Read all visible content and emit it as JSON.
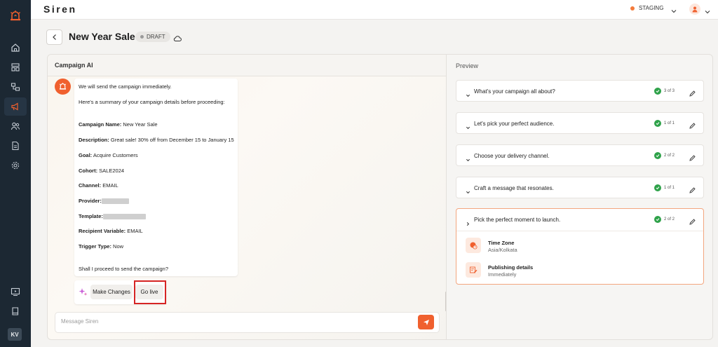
{
  "app": {
    "brand": "Siren",
    "environment": "STAGING",
    "user_initials": "KV"
  },
  "header": {
    "title": "New Year Sale",
    "status_badge": "DRAFT"
  },
  "campaign_ai": {
    "panel_title": "Campaign AI",
    "message": {
      "intro": "We will send the campaign immediately.",
      "summary_intro": "Here's a summary of your campaign details before proceeding:",
      "fields": [
        {
          "label": "Campaign Name:",
          "value": "New Year Sale"
        },
        {
          "label": "Description:",
          "value": "Great sale! 30% off from December 15 to January 15"
        },
        {
          "label": "Goal:",
          "value": "Acquire Customers"
        },
        {
          "label": "Cohort:",
          "value": "SALE2024"
        },
        {
          "label": "Channel:",
          "value": "EMAIL"
        },
        {
          "label": "Provider:",
          "value": ""
        },
        {
          "label": "Template:",
          "value": ""
        },
        {
          "label": "Recipient Variable:",
          "value": "EMAIL"
        },
        {
          "label": "Trigger Type:",
          "value": "Now"
        }
      ],
      "question": "Shall I proceed to send the campaign?"
    },
    "actions": {
      "make_changes": "Make Changes",
      "go_live": "Go live"
    },
    "input_placeholder": "Message Siren"
  },
  "preview": {
    "title": "Preview",
    "steps": [
      {
        "label": "What's your campaign all about?",
        "count": "3 of 3"
      },
      {
        "label": "Let's pick your perfect audience.",
        "count": "1 of 1"
      },
      {
        "label": "Choose your delivery channel.",
        "count": "2 of 2"
      },
      {
        "label": "Craft a message that resonates.",
        "count": "1 of 1"
      },
      {
        "label": "Pick the perfect moment to launch.",
        "count": "2 of 2"
      }
    ],
    "launch_details": [
      {
        "title": "Time Zone",
        "value": "Asia/Kolkata",
        "icon": "globe-clock-icon"
      },
      {
        "title": "Publishing details",
        "value": "Immediately",
        "icon": "calendar-edit-icon"
      }
    ]
  },
  "colors": {
    "accent": "#f0602e",
    "sidebar": "#1c2833",
    "success": "#2fa24a",
    "highlight": "#d62525"
  }
}
